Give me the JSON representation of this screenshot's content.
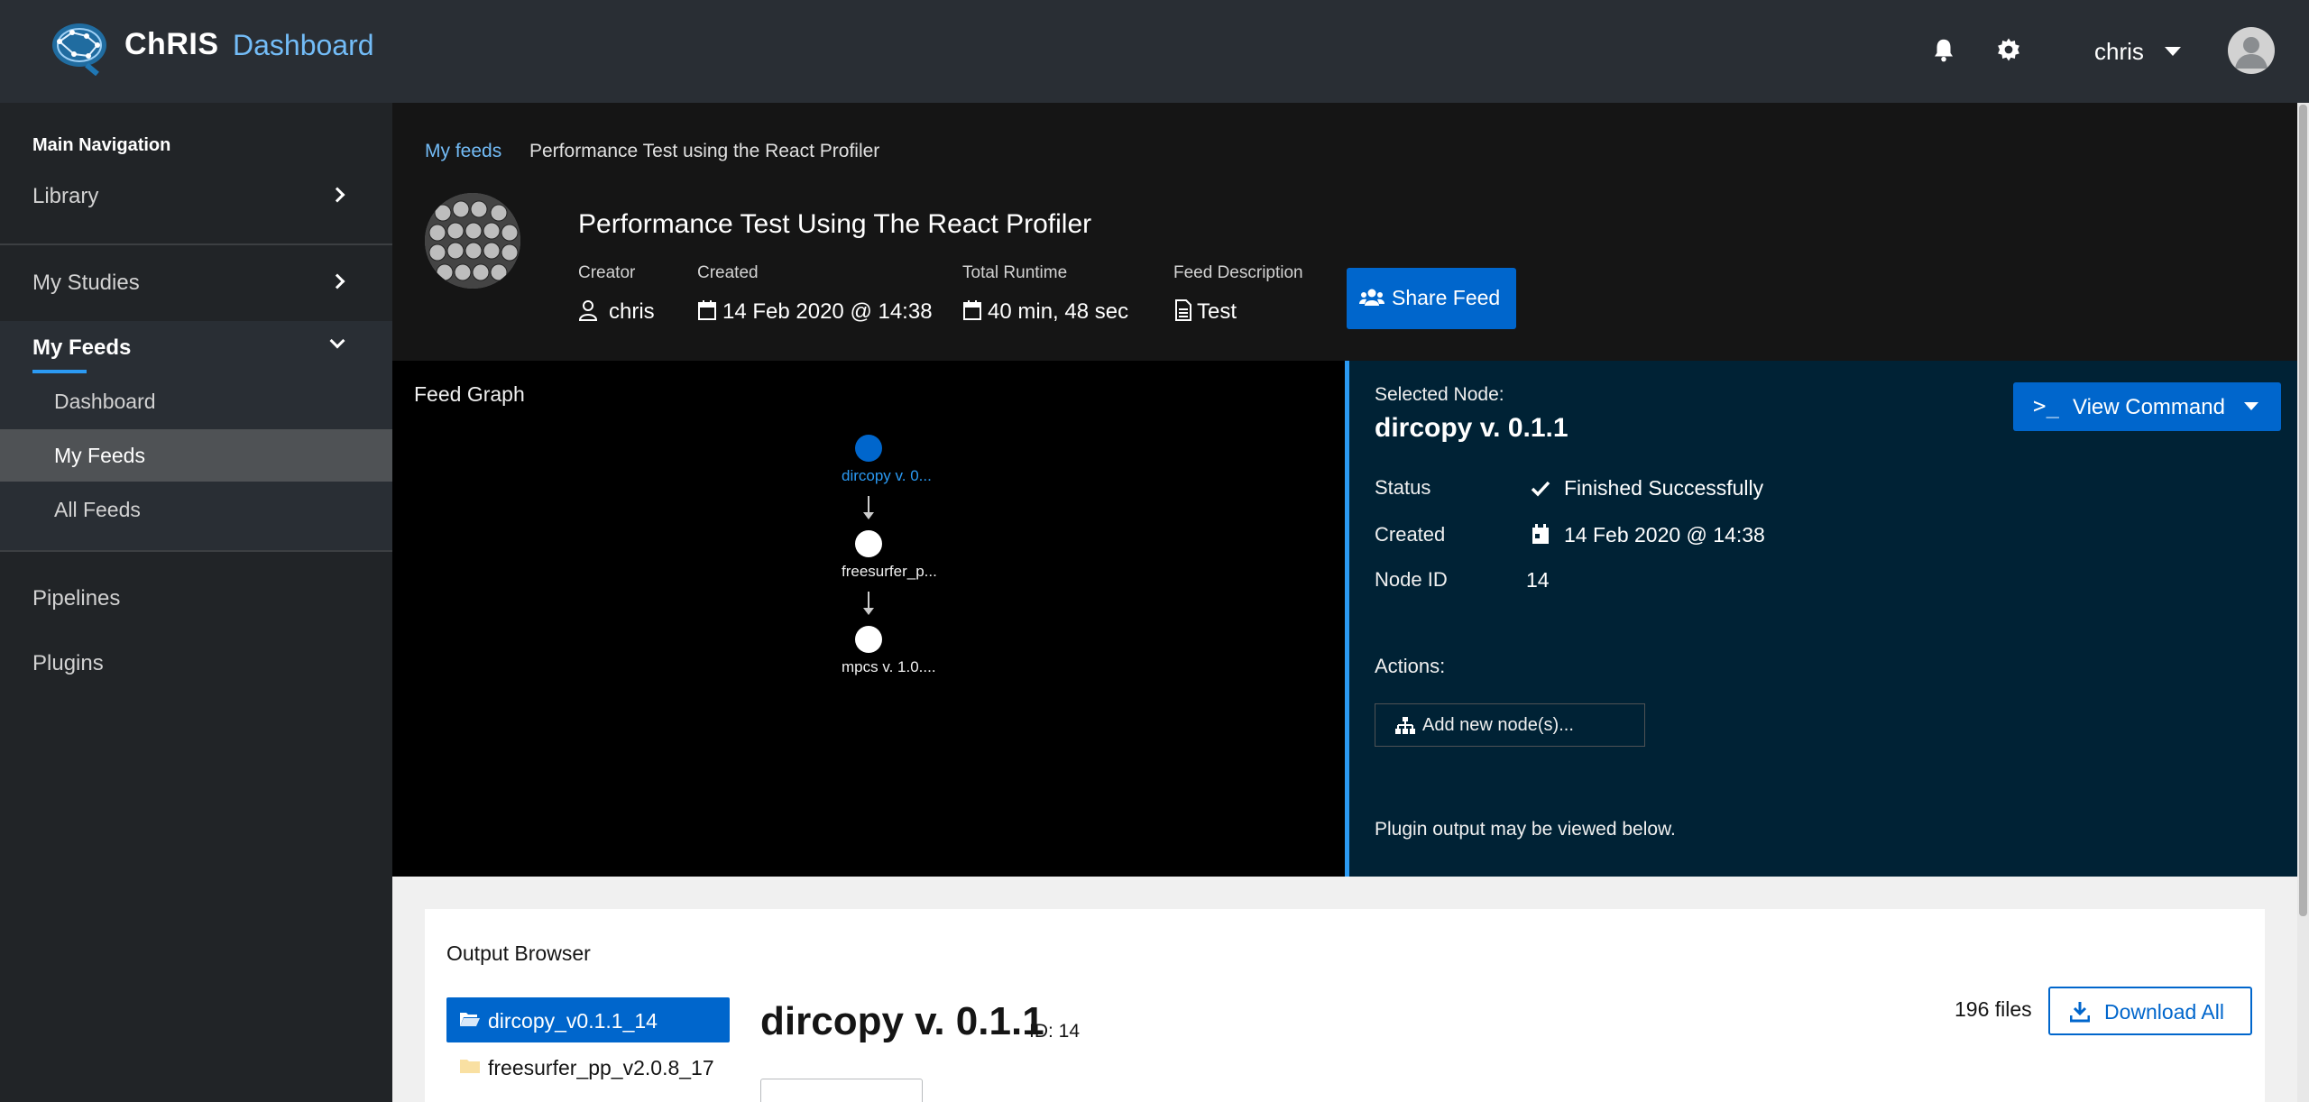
{
  "header": {
    "brand": "ChRIS",
    "brand_sub": "Dashboard",
    "user": "chris"
  },
  "sidebar": {
    "title": "Main Navigation",
    "items": [
      {
        "label": "Library"
      },
      {
        "label": "My Studies"
      },
      {
        "label": "My Feeds"
      },
      {
        "label": "Pipelines"
      },
      {
        "label": "Plugins"
      }
    ],
    "feeds_sub": [
      {
        "label": "Dashboard"
      },
      {
        "label": "My Feeds"
      },
      {
        "label": "All Feeds"
      }
    ]
  },
  "breadcrumb": {
    "link": "My feeds",
    "current": "Performance Test using the React Profiler"
  },
  "feed": {
    "title": "Performance Test Using The React Profiler",
    "creator_label": "Creator",
    "creator": "chris",
    "created_label": "Created",
    "created": "14 Feb 2020 @ 14:38",
    "runtime_label": "Total Runtime",
    "runtime": "40 min, 48 sec",
    "description_label": "Feed Description",
    "description": "Test",
    "share_label": "Share Feed"
  },
  "graph": {
    "title": "Feed Graph",
    "nodes": [
      {
        "label": "dircopy v. 0..."
      },
      {
        "label": "freesurfer_p..."
      },
      {
        "label": "mpcs v. 1.0...."
      }
    ]
  },
  "node": {
    "selected_label": "Selected Node:",
    "name": "dircopy v. 0.1.1",
    "view_command": "View Command",
    "status_label": "Status",
    "status": "Finished Successfully",
    "created_label": "Created",
    "created": "14 Feb 2020 @ 14:38",
    "id_label": "Node ID",
    "id": "14",
    "actions_label": "Actions:",
    "add_node": "Add new node(s)...",
    "footer": "Plugin output may be viewed below."
  },
  "output": {
    "title": "Output Browser",
    "tree": [
      {
        "label": "dircopy_v0.1.1_14"
      },
      {
        "label": "freesurfer_pp_v2.0.8_17"
      }
    ],
    "plugin_name": "dircopy v. 0.1.1",
    "plugin_id": "ID: 14",
    "file_count": "196 files",
    "download_label": "Download All"
  },
  "colors": {
    "accent": "#0066cc",
    "link": "#73bcf7",
    "header_bg": "#292e34",
    "panel_bg": "#002235"
  }
}
